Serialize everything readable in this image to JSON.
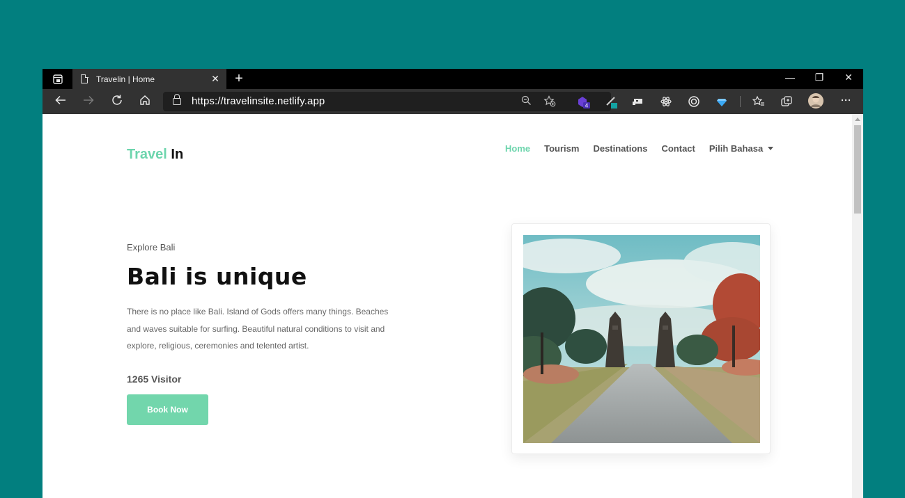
{
  "browser": {
    "tab_title": "Travelin | Home",
    "tab_close": "✕",
    "new_tab": "+",
    "url_scheme": "https://",
    "url_host": "travelinsite.netlify.app",
    "ext_badge": "4",
    "window_minimize": "—",
    "window_restore": "❐",
    "window_close": "✕"
  },
  "site": {
    "logo_part1": "Travel",
    "logo_part2": "In",
    "nav": [
      {
        "label": "Home",
        "active": true
      },
      {
        "label": "Tourism"
      },
      {
        "label": "Destinations"
      },
      {
        "label": "Contact"
      },
      {
        "label": "Pilih Bahasa"
      }
    ]
  },
  "hero": {
    "eyebrow": "Explore Bali",
    "title": "Bali is unique",
    "description": "There is no place like Bali. Island of Gods offers many things. Beaches and waves suitable for surfing. Beautiful natural conditions to visit and explore, religious, ceremonies and telented artist.",
    "visitor": "1265 Visitor",
    "cta": "Book Now"
  },
  "colors": {
    "accent": "#6dd5ad",
    "desktop_bg": "#027f7f"
  }
}
